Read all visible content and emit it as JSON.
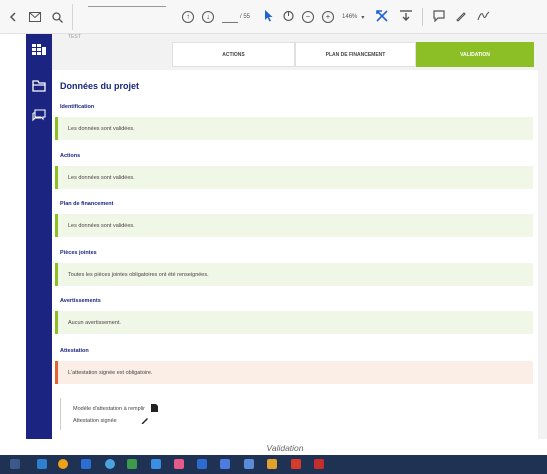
{
  "pdf_toolbar": {
    "page_current": "",
    "page_total": "/ 55",
    "zoom": "146%"
  },
  "app": {
    "test_label": "TEST",
    "tabs": [
      {
        "label": "ACTIONS"
      },
      {
        "label": "PLAN DE FINANCEMENT"
      },
      {
        "label": "VALIDATION"
      }
    ],
    "card_title": "Données du projet",
    "sections": [
      {
        "title": "Identification",
        "message": "Les données sont validées."
      },
      {
        "title": "Actions",
        "message": "Les données sont validées."
      },
      {
        "title": "Plan de financement",
        "message": "Les données sont validées."
      },
      {
        "title": "Pièces jointes",
        "message": "Toutes les pièces jointes obligatoires ont été renseignées."
      },
      {
        "title": "Avertissements",
        "message": "Aucun avertissement."
      },
      {
        "title": "Attestation",
        "message": "L'attestation signée est obligatoire."
      }
    ],
    "attestation_links": {
      "model_label": "Modèle d'attestation à  remplir",
      "signed_label": "Attestation signée"
    }
  },
  "caption": "Validation",
  "colors": {
    "sidebar": "#1b2581",
    "accent_green": "#8cbf26",
    "warning": "#e2632f",
    "taskbar": "#1f3253"
  }
}
